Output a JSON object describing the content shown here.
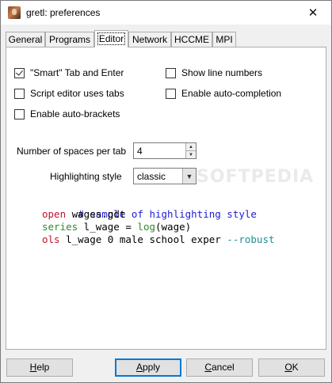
{
  "window": {
    "title": "gretl: preferences",
    "close_glyph": "✕"
  },
  "tabs": [
    {
      "label": "General",
      "active": false
    },
    {
      "label": "Programs",
      "active": false
    },
    {
      "label": "Editor",
      "active": true
    },
    {
      "label": "Network",
      "active": false
    },
    {
      "label": "HCCME",
      "active": false
    },
    {
      "label": "MPI",
      "active": false
    }
  ],
  "editor": {
    "checkboxes": {
      "smart_tab": {
        "label": "\"Smart\" Tab and Enter",
        "checked": true
      },
      "show_line_numbers": {
        "label": "Show line numbers",
        "checked": false
      },
      "script_tabs": {
        "label": "Script editor uses tabs",
        "checked": false
      },
      "auto_completion": {
        "label": "Enable auto-completion",
        "checked": false
      },
      "auto_brackets": {
        "label": "Enable auto-brackets",
        "checked": false
      }
    },
    "spaces_per_tab": {
      "label": "Number of spaces per tab",
      "value": "4"
    },
    "highlighting_style": {
      "label": "Highlighting style",
      "value": "classic"
    },
    "sample_code": {
      "line1": "# sample of highlighting style",
      "line2_kw": "open",
      "line2_rest": " wages.gdt",
      "line3_kw": "series",
      "line3_mid": " l_wage = ",
      "line3_fn": "log",
      "line3_rest": "(wage)",
      "line4_kw": "ols",
      "line4_mid": " l_wage 0 male school exper ",
      "line4_opt": "--robust"
    }
  },
  "buttons": {
    "help": {
      "mnemonic": "H",
      "rest": "elp"
    },
    "apply": {
      "mnemonic": "A",
      "rest": "pply"
    },
    "cancel": {
      "mnemonic": "C",
      "rest": "ancel"
    },
    "ok": {
      "mnemonic": "O",
      "rest": "K"
    }
  },
  "watermark": "SOFTPEDIA",
  "colors": {
    "comment": "#1c1cd6",
    "keyword": "#c0142a",
    "function": "#2a8a2a",
    "option": "#1e8f8f",
    "focus_border": "#0078d7"
  }
}
